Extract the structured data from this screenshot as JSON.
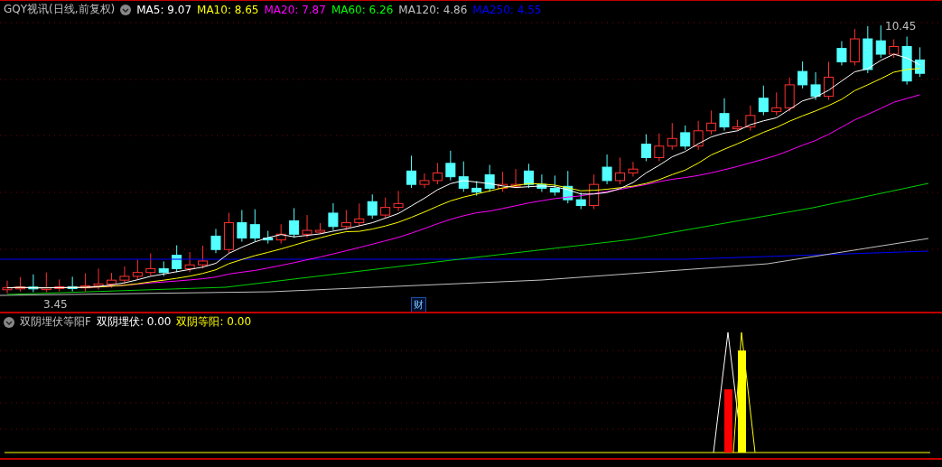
{
  "main_chart": {
    "title": "GQY视讯(日线,前复权)",
    "readouts": [
      {
        "label": "MA5: 9.07",
        "color": "#ffffff"
      },
      {
        "label": "MA10: 8.65",
        "color": "#ffff00"
      },
      {
        "label": "MA20: 7.87",
        "color": "#ff00ff"
      },
      {
        "label": "MA60: 6.26",
        "color": "#00ff00"
      },
      {
        "label": "MA120: 4.86",
        "color": "#c0c0c0"
      },
      {
        "label": "MA250: 4.55",
        "color": "#0000ff"
      }
    ],
    "high_marker": "10.45",
    "low_marker": "3.45",
    "badge": "财"
  },
  "indicator": {
    "title": "双阴埋伏等阳F",
    "readouts": [
      {
        "label": "双阴埋伏: 0.00",
        "color": "#ffffff"
      },
      {
        "label": "双阴等阳: 0.00",
        "color": "#ffff00"
      }
    ]
  }
}
